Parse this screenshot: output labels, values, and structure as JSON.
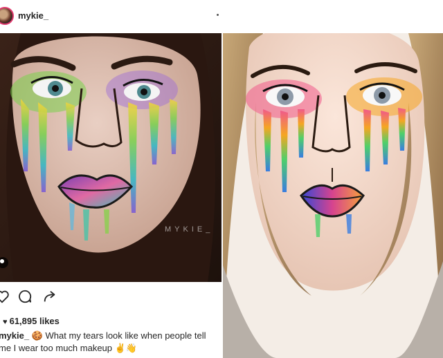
{
  "post": {
    "username": "mykie_",
    "likes": "61,895 likes",
    "caption_user": "mykie_",
    "caption_text": "What my tears look like when people tell me I wear too much makeup",
    "caption_emojis": "🍪 ✌👋",
    "watermark": "MYKIE_"
  },
  "icons": {
    "heart": "heart-icon",
    "comment": "comment-icon",
    "share": "share-icon",
    "more": "more-options-icon",
    "tag": "user-tag-icon"
  }
}
